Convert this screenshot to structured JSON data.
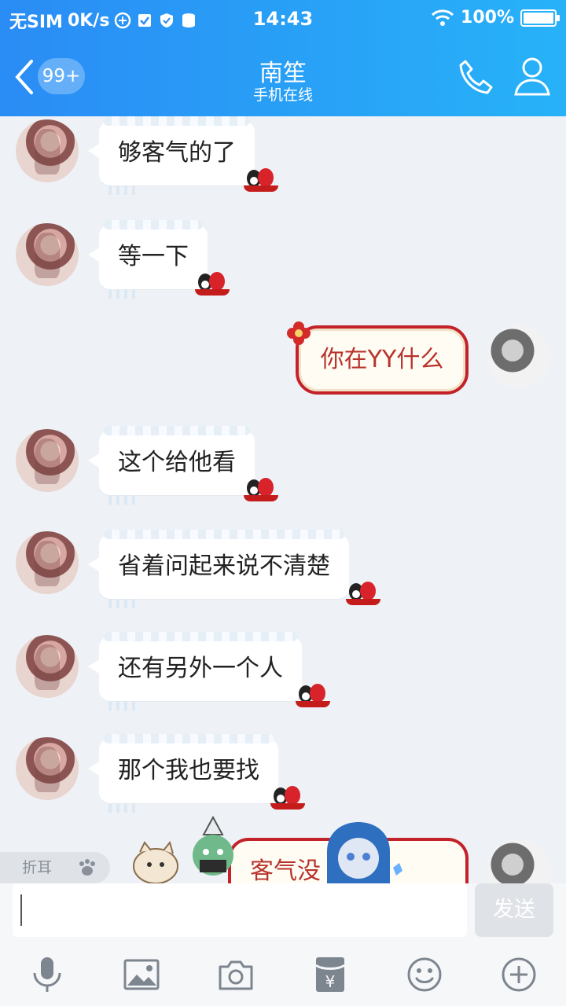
{
  "status_bar": {
    "carrier": "无SIM",
    "speed": "0K/s",
    "time": "14:43",
    "battery": "100%"
  },
  "header": {
    "unread_badge": "99+",
    "title": "南笙",
    "subtitle": "手机在线"
  },
  "messages": [
    {
      "from": "other",
      "text": "够客气的了"
    },
    {
      "from": "other",
      "text": "等一下"
    },
    {
      "from": "me",
      "text": "你在YY什么"
    },
    {
      "from": "other",
      "text": "这个给他看"
    },
    {
      "from": "other",
      "text": "省着问起来说不清楚"
    },
    {
      "from": "other",
      "text": "还有另外一个人"
    },
    {
      "from": "other",
      "text": "那个我也要找"
    },
    {
      "from": "me",
      "text": "客气没        气吗"
    }
  ],
  "fold_tab": {
    "label": "折耳"
  },
  "composer": {
    "input_value": "",
    "send_label": "发送"
  },
  "toolbar": {
    "icons": [
      "microphone-icon",
      "image-icon",
      "camera-icon",
      "red-packet-icon",
      "emoji-icon",
      "plus-icon"
    ]
  },
  "colors": {
    "header_start": "#2a8cf5",
    "header_end": "#27b2f8",
    "chat_bg": "#eef2f7",
    "outgoing_border": "#c3222a",
    "outgoing_text": "#b8332d"
  }
}
